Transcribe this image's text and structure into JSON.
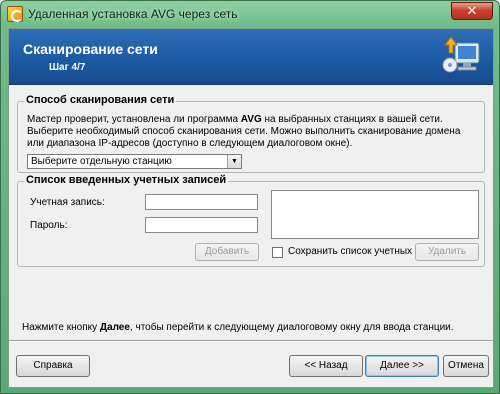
{
  "window": {
    "title": "Удаленная установка AVG через сеть",
    "close_glyph": "✕"
  },
  "banner": {
    "title": "Сканирование сети",
    "step": "Шаг 4/7"
  },
  "scan_method": {
    "title": "Способ сканирования сети",
    "description_pre": "Мастер проверит, установлена ли программа ",
    "description_brand": "AVG",
    "description_post": " на выбранных станциях в вашей сети. Выберите необходимый способ сканирования сети. Можно выполнить сканирование домена или диапазона IP-адресов (доступно в следующем диалоговом окне).",
    "selected_option": "Выберите отдельную станцию"
  },
  "credentials": {
    "title": "Список введенных учетных записей",
    "account_label": "Учетная запись:",
    "password_label": "Пароль:",
    "add_button": "Добавить",
    "save_list_label": "Сохранить список учетных",
    "remove_button": "Удалить"
  },
  "footer": {
    "hint_pre": "Нажмите кнопку ",
    "hint_bold": "Далее",
    "hint_post": ", чтобы перейти к следующему диалоговому окну для ввода станции.",
    "help_button": "Справка",
    "back_button": "<< Назад",
    "next_button": "Далее >>",
    "cancel_button": "Отмена"
  }
}
